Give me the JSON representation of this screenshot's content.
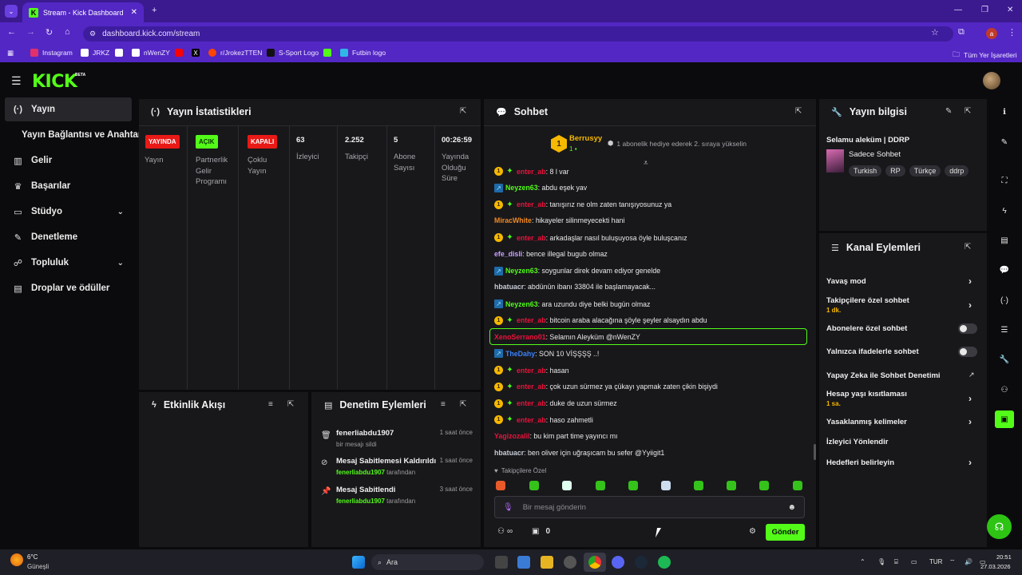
{
  "browser": {
    "tab_title": "Stream - Kick Dashboard",
    "url": "dashboard.kick.com/stream",
    "profile_initial": "a",
    "bookmarks": [
      "Instagram",
      "JRKZ",
      "nWenZY",
      "r/JrokezTTEN",
      "S-Sport Logo",
      "Futbin logo"
    ],
    "all_bookmarks": "Tüm Yer İşaretleri"
  },
  "kick": {
    "logo": "KICK",
    "beta": "BETA"
  },
  "nav": [
    {
      "label": "Yayın",
      "icon": "live-icon",
      "glyph": "(·)"
    },
    {
      "label": "Yayın Bağlantısı ve Anahtarı",
      "icon": "",
      "glyph": ""
    },
    {
      "label": "Gelir",
      "icon": "chart-icon",
      "glyph": "▥"
    },
    {
      "label": "Başarılar",
      "icon": "trophy-icon",
      "glyph": "🏆"
    },
    {
      "label": "Stüdyo",
      "icon": "studio-icon",
      "glyph": "▭"
    },
    {
      "label": "Denetleme",
      "icon": "wrench-icon",
      "glyph": "🔧"
    },
    {
      "label": "Topluluk",
      "icon": "community-icon",
      "glyph": "👥"
    },
    {
      "label": "Droplar ve ödüller",
      "icon": "drops-icon",
      "glyph": "▤"
    }
  ],
  "stats": {
    "title": "Yayın İstatistikleri",
    "items": [
      {
        "badge": "YAYINDA",
        "label": "Yayın",
        "badge_color": "#e91916"
      },
      {
        "badge": "AÇIK",
        "label": "Partnerlik Gelir Programı",
        "badge_color": "#53fc18"
      },
      {
        "badge": "KAPALI",
        "label": "Çoklu Yayın",
        "badge_color": "#e91916"
      },
      {
        "value": "63",
        "label": "İzleyici"
      },
      {
        "value": "2.252",
        "label": "Takipçi"
      },
      {
        "value": "5",
        "label": "Abone Sayısı"
      },
      {
        "value": "00:26:59",
        "label": "Yayında Olduğu Süre"
      }
    ]
  },
  "activity": {
    "title": "Etkinlik Akışı"
  },
  "moderation": {
    "title": "Denetim Eylemleri",
    "items": [
      {
        "title": "fenerliabdu1907",
        "sub": "bir mesajı sildi",
        "by": "",
        "time": "1 saat önce"
      },
      {
        "title": "Mesaj Sabitlemesi Kaldırıldı",
        "sub": "tarafından",
        "by": "fenerliabdu1907",
        "time": "1 saat önce"
      },
      {
        "title": "Mesaj Sabitlendi",
        "sub": "tarafından",
        "by": "fenerliabdu1907",
        "time": "3 saat önce"
      }
    ]
  },
  "chat": {
    "title": "Sohbet",
    "gifter": "Berrusyy",
    "gifter_count": "1",
    "gift_text": "1 abonelik hediye ederek 2. sıraya yükselin",
    "messages": [
      {
        "user": "enter_ab",
        "color": "#e9123a",
        "text": ": 8 l var",
        "badges": [
          "sub",
          "gift"
        ]
      },
      {
        "user": "Neyzen63",
        "color": "#53fc18",
        "text": ": abdu eşek yav",
        "badges": [
          "og"
        ]
      },
      {
        "user": "enter_ab",
        "color": "#e9123a",
        "text": ": tanışırız ne olm zaten tanışıyosunuz ya",
        "badges": [
          "sub",
          "gift"
        ]
      },
      {
        "user": "MiracWhite",
        "color": "#f08a24",
        "text": ": hikayeler silinmeyecekti hani",
        "badges": []
      },
      {
        "user": "enter_ab",
        "color": "#e9123a",
        "text": ": arkadaşlar nasıl buluşuyosa öyle buluşcanız",
        "badges": [
          "sub",
          "gift"
        ]
      },
      {
        "user": "efe_disli",
        "color": "#c9a0ff",
        "text": ": bence illegal bugub olmaz",
        "badges": []
      },
      {
        "user": "Neyzen63",
        "color": "#53fc18",
        "text": ": soygunlar direk devam ediyor genelde",
        "badges": [
          "og"
        ]
      },
      {
        "user": "hbatuacr",
        "color": "#c7ccd6",
        "text": ": abdünün ibanı 33804 ile başlamayacak...",
        "badges": []
      },
      {
        "user": "Neyzen63",
        "color": "#53fc18",
        "text": ": ara uzundu diye belki bugün olmaz",
        "badges": [
          "og"
        ]
      },
      {
        "user": "enter_ab",
        "color": "#e9123a",
        "text": ": bitcoin araba alacağına şöyle şeyler alsaydın abdu",
        "badges": [
          "sub",
          "gift"
        ]
      },
      {
        "user": "XenoSerrano01",
        "color": "#e9123a",
        "text": ": Selamın Aleyküm @nWenZY",
        "badges": [],
        "highlight": true
      },
      {
        "user": "TheDahy",
        "color": "#3b82f6",
        "text": ": SON 10 VİŞŞŞŞ ..!",
        "badges": [
          "og"
        ]
      },
      {
        "user": "enter_ab",
        "color": "#e9123a",
        "text": ": hasan",
        "badges": [
          "sub",
          "gift"
        ]
      },
      {
        "user": "enter_ab",
        "color": "#e9123a",
        "text": ": çok uzun sürmez ya çükayı yapmak zaten çikin bişiydi",
        "badges": [
          "sub",
          "gift"
        ]
      },
      {
        "user": "enter_ab",
        "color": "#e9123a",
        "text": ": duke de uzun sürmez",
        "badges": [
          "sub",
          "gift"
        ]
      },
      {
        "user": "enter_ab",
        "color": "#e9123a",
        "text": ": haso zahmetli",
        "badges": [
          "sub",
          "gift"
        ]
      },
      {
        "user": "Yagizozalil",
        "color": "#e9123a",
        "text": ": bu kim part time yayıncı mı",
        "badges": []
      },
      {
        "user": "hbatuacr",
        "color": "#c7ccd6",
        "text": ": ben oliver için uğraşıcam bu sefer @Yyiigit1",
        "badges": []
      }
    ],
    "followers_only": "Takipçilere Özel",
    "input_placeholder": "Bir mesaj gönderin",
    "bottom_infinity": "∞",
    "bottom_count": "0",
    "send_label": "Gönder"
  },
  "stream_info": {
    "title_header": "Yayın bilgisi",
    "stream_title": "Selamu aleküm | DDRP",
    "category": "Sadece Sohbet",
    "tags": [
      "Turkish",
      "RP",
      "Türkçe",
      "ddrp"
    ]
  },
  "channel_actions": {
    "title": "Kanal Eylemleri",
    "items": [
      {
        "label": "Yavaş mod",
        "control": "chevron"
      },
      {
        "label": "Takipçilere özel sohbet",
        "sub": "1 dk.",
        "control": "chevron"
      },
      {
        "label": "Abonelere özel sohbet",
        "control": "toggle"
      },
      {
        "label": "Yalnızca ifadelerle sohbet",
        "control": "toggle"
      },
      {
        "label": "Yapay Zeka ile Sohbet Denetimi",
        "control": "external"
      },
      {
        "label": "Hesap yaşı kısıtlaması",
        "sub": "1 sa.",
        "control": "chevron"
      },
      {
        "label": "Yasaklanmış kelimeler",
        "control": "chevron"
      },
      {
        "label": "İzleyici Yönlendir",
        "control": "none"
      },
      {
        "label": "Hedefleri belirleyin",
        "control": "chevron"
      }
    ]
  },
  "taskbar": {
    "weather_temp": "6°C",
    "weather_text": "Güneşli",
    "search_label": "Ara",
    "lang": "TUR",
    "time": "20:51",
    "date": "27.03.2026"
  },
  "colors": {
    "kick_green": "#53fc18",
    "panel": "#18181b",
    "bg": "#0b0b0d",
    "chrome_purple": "#5327c4"
  }
}
